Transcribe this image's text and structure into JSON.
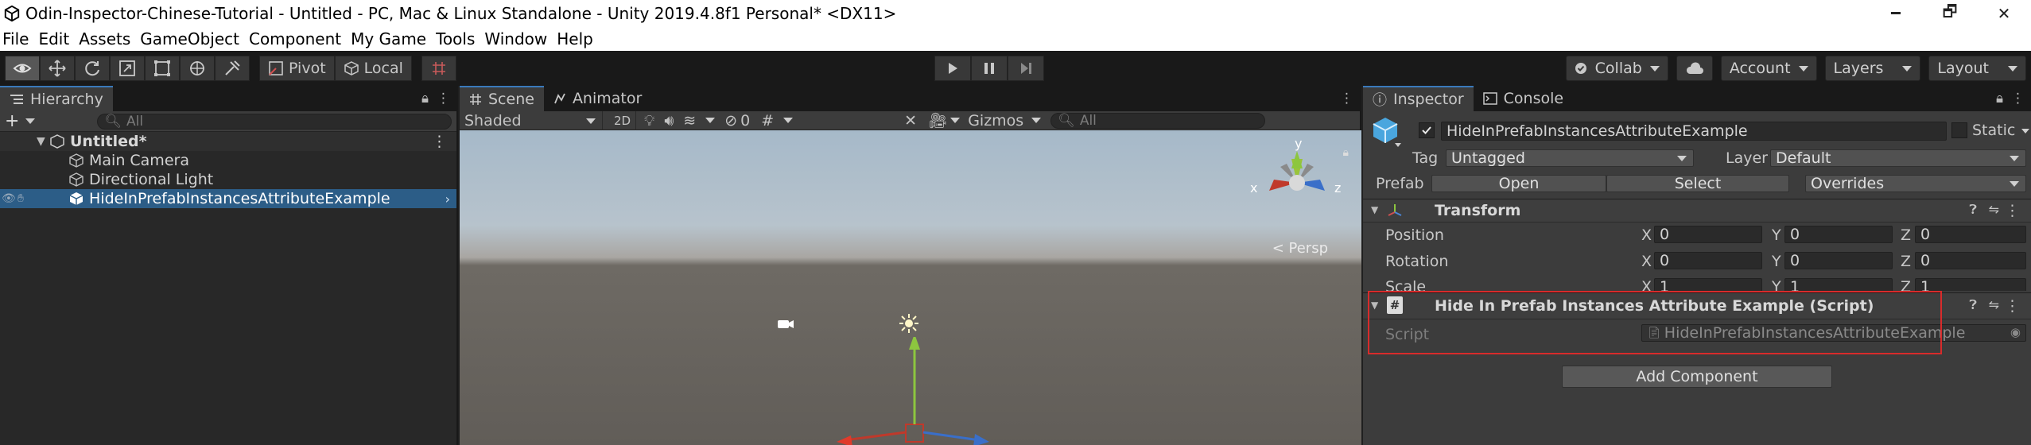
{
  "window": {
    "title": "Odin-Inspector-Chinese-Tutorial - Untitled - PC, Mac & Linux Standalone - Unity 2019.4.8f1 Personal* <DX11>",
    "minimize": "🗕",
    "maximize": "🗗",
    "close": "✕"
  },
  "menu": [
    "File",
    "Edit",
    "Assets",
    "GameObject",
    "Component",
    "My Game",
    "Tools",
    "Window",
    "Help"
  ],
  "toolbar": {
    "pivot_label": "Pivot",
    "local_label": "Local",
    "collab_label": "Collab",
    "account_label": "Account",
    "layers_label": "Layers",
    "layout_label": "Layout"
  },
  "hierarchy": {
    "tab_label": "Hierarchy",
    "search_placeholder": "All",
    "scene_name": "Untitled*",
    "items": [
      {
        "label": "Main Camera"
      },
      {
        "label": "Directional Light"
      },
      {
        "label": "HideInPrefabInstancesAttributeExample"
      }
    ]
  },
  "scene": {
    "tab_label": "Scene",
    "animator_tab_label": "Animator",
    "shading_mode": "Shaded",
    "mode_2d": "2D",
    "hidden_count": "0",
    "gizmos_label": "Gizmos",
    "search_placeholder": "All",
    "persp_label": "< Persp",
    "axis_x": "x",
    "axis_y": "y",
    "axis_z": "z"
  },
  "inspector": {
    "tab_label": "Inspector",
    "console_tab_label": "Console",
    "object_name": "HideInPrefabInstancesAttributeExample",
    "static_label": "Static",
    "tag_label": "Tag",
    "tag_value": "Untagged",
    "layer_label": "Layer",
    "layer_value": "Default",
    "prefab_label": "Prefab",
    "prefab_open": "Open",
    "prefab_select": "Select",
    "prefab_overrides": "Overrides",
    "transform_title": "Transform",
    "position_label": "Position",
    "rotation_label": "Rotation",
    "scale_label": "Scale",
    "x_label": "X",
    "y_label": "Y",
    "z_label": "Z",
    "position": {
      "x": "0",
      "y": "0",
      "z": "0"
    },
    "rotation": {
      "x": "0",
      "y": "0",
      "z": "0"
    },
    "scale": {
      "x": "1",
      "y": "1",
      "z": "1"
    },
    "script_component_title": "Hide In Prefab Instances Attribute Example (Script)",
    "script_label": "Script",
    "script_value": "HideInPrefabInstancesAttributeExample",
    "add_component_label": "Add Component"
  },
  "colors": {
    "selection": "#2c5d87",
    "highlight_box": "#d82b2b",
    "tab_accent": "#3a79bb"
  }
}
